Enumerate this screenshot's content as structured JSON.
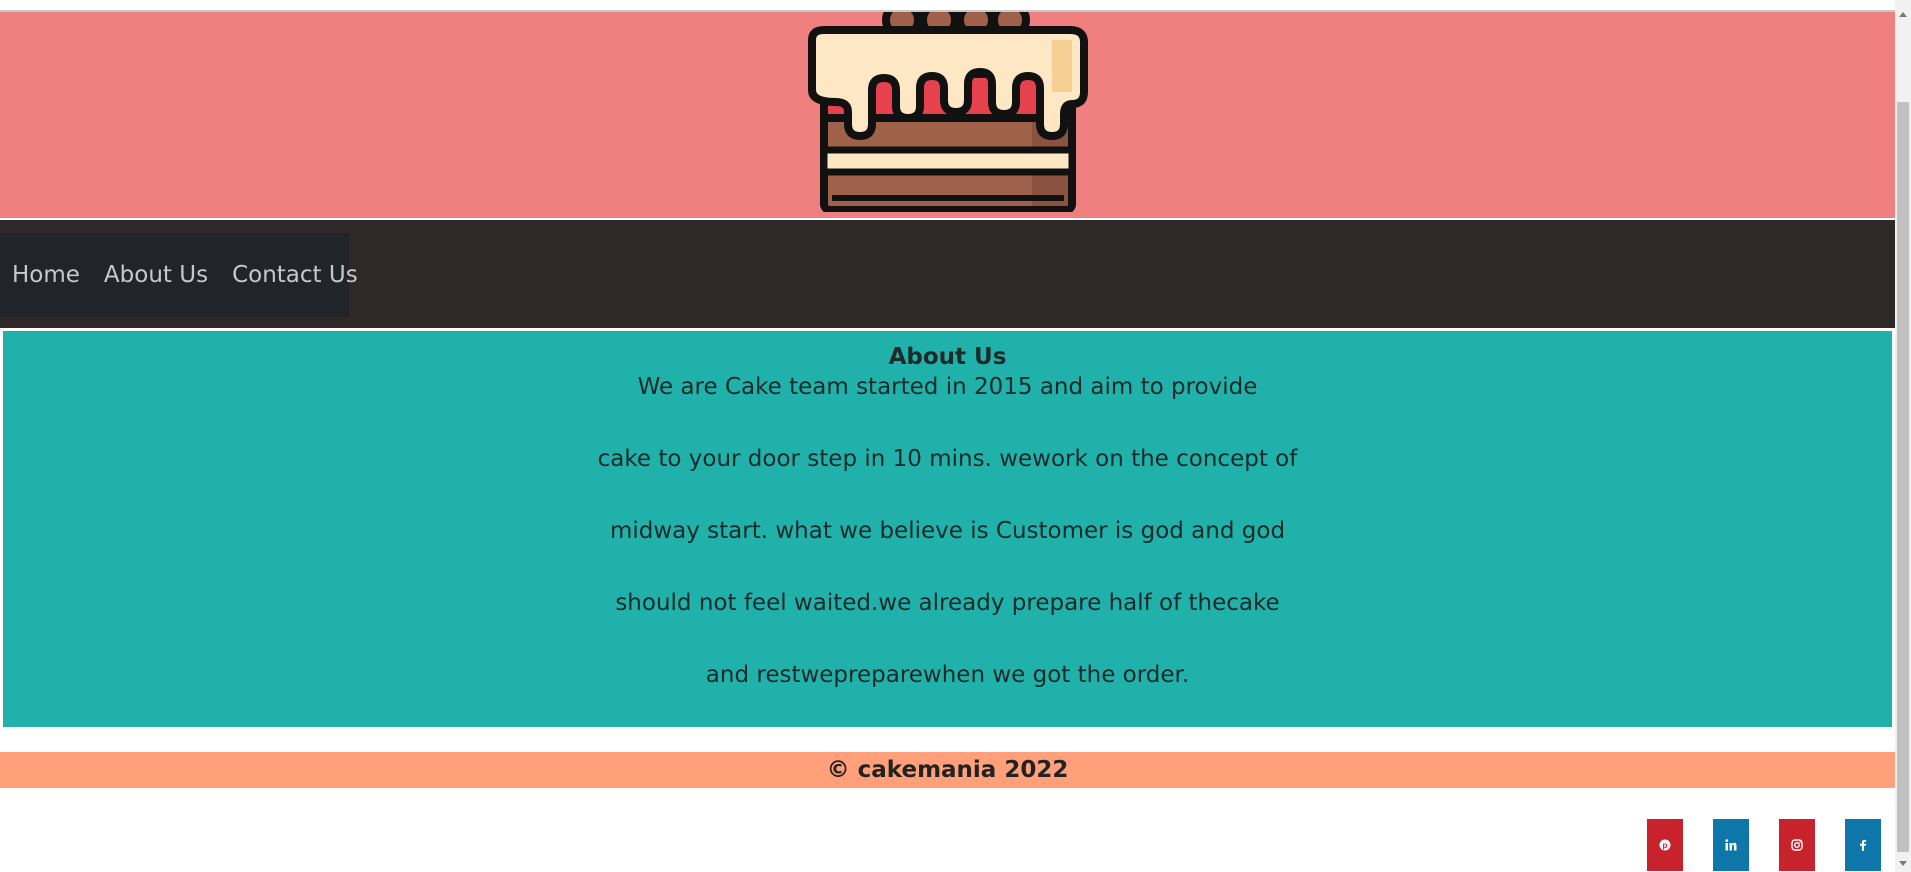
{
  "nav": {
    "links": [
      "Home",
      "About Us",
      "Contact Us"
    ]
  },
  "about": {
    "title": "About Us",
    "lines": [
      "We are Cake team started in 2015 and aim to provide",
      "cake to your door step in 10 mins. wework on the concept of",
      "midway start. what we believe is Customer is god and god",
      "should not feel waited.we already prepare half of thecake",
      "and restweprepar​ewhen we got the order."
    ]
  },
  "footer": {
    "copyright": "© cakemania 2022"
  },
  "social": [
    {
      "icon": "pinterest-icon",
      "color": "#c8232c"
    },
    {
      "icon": "linkedin-icon",
      "color": "#0e76a8"
    },
    {
      "icon": "instagram-icon",
      "color": "#c8232c"
    },
    {
      "icon": "facebook-icon",
      "color": "#0e76a8"
    }
  ],
  "colors": {
    "banner": "#f08080",
    "navbar": "#2e2828",
    "about": "#20b2aa",
    "footer": "#ffa07a"
  }
}
